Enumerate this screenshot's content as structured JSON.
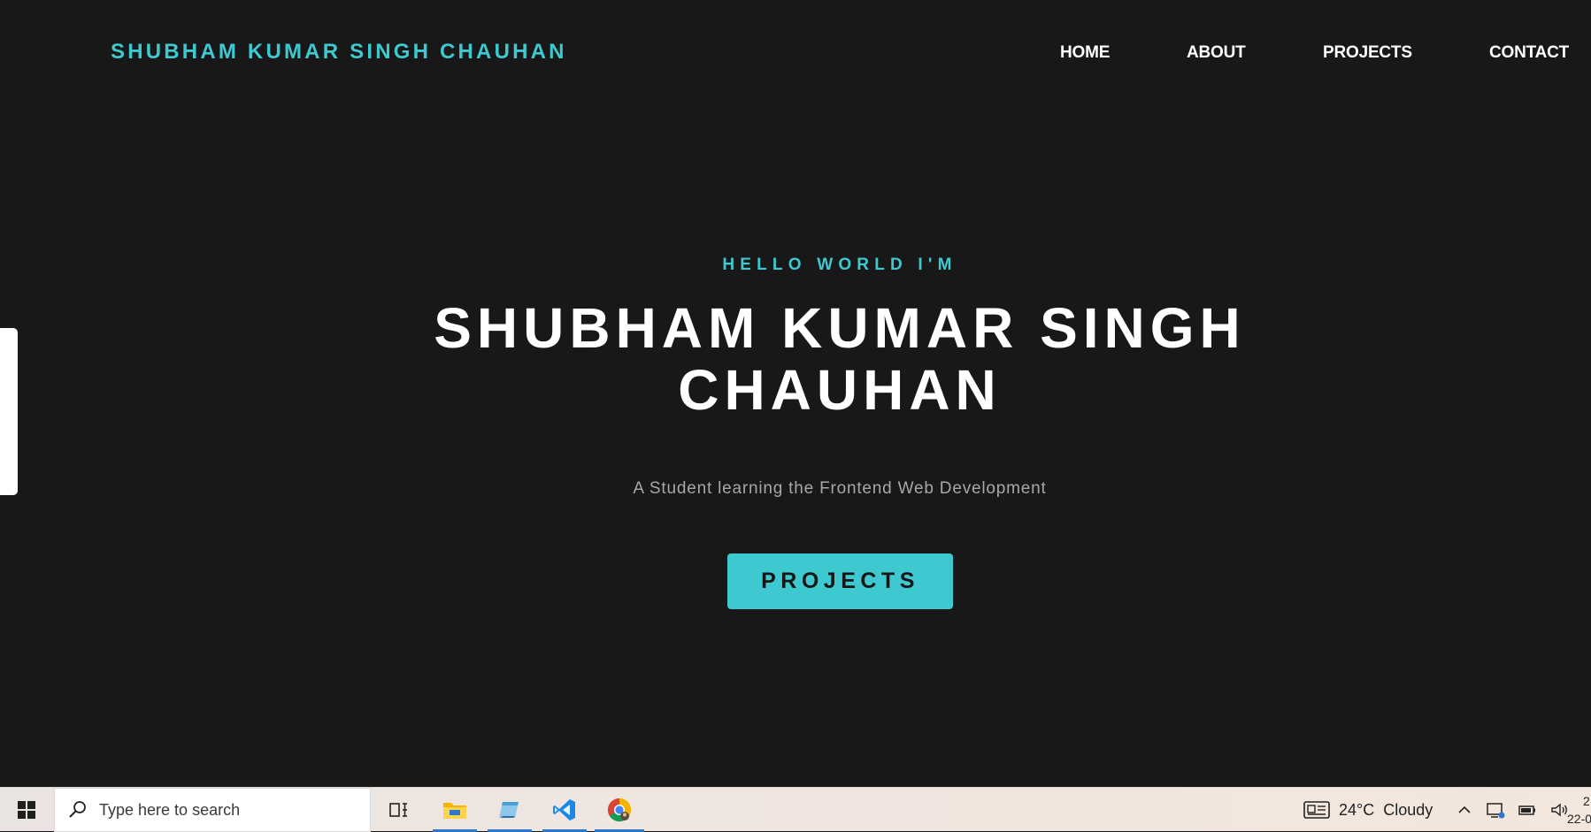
{
  "header": {
    "logo": "SHUBHAM KUMAR SINGH CHAUHAN",
    "nav": [
      "HOME",
      "ABOUT",
      "PROJECTS",
      "CONTACT"
    ]
  },
  "hero": {
    "greeting": "HELLO WORLD I'M",
    "name_line1": "SHUBHAM KUMAR SINGH",
    "name_line2": "CHAUHAN",
    "tagline": "A Student learning the Frontend Web Development",
    "cta_label": "PROJECTS"
  },
  "taskbar": {
    "search_placeholder": "Type here to search",
    "pinned_icons": [
      "task-view-icon",
      "file-explorer-icon",
      "notepad-icon",
      "vscode-icon",
      "chrome-icon"
    ],
    "weather": "24°C  Cloudy",
    "clock_time": "2",
    "clock_date": "22-0"
  },
  "colors": {
    "background": "#181818",
    "accent": "#3ec9d1",
    "text": "#ffffff",
    "muted": "#a7a7a7"
  }
}
